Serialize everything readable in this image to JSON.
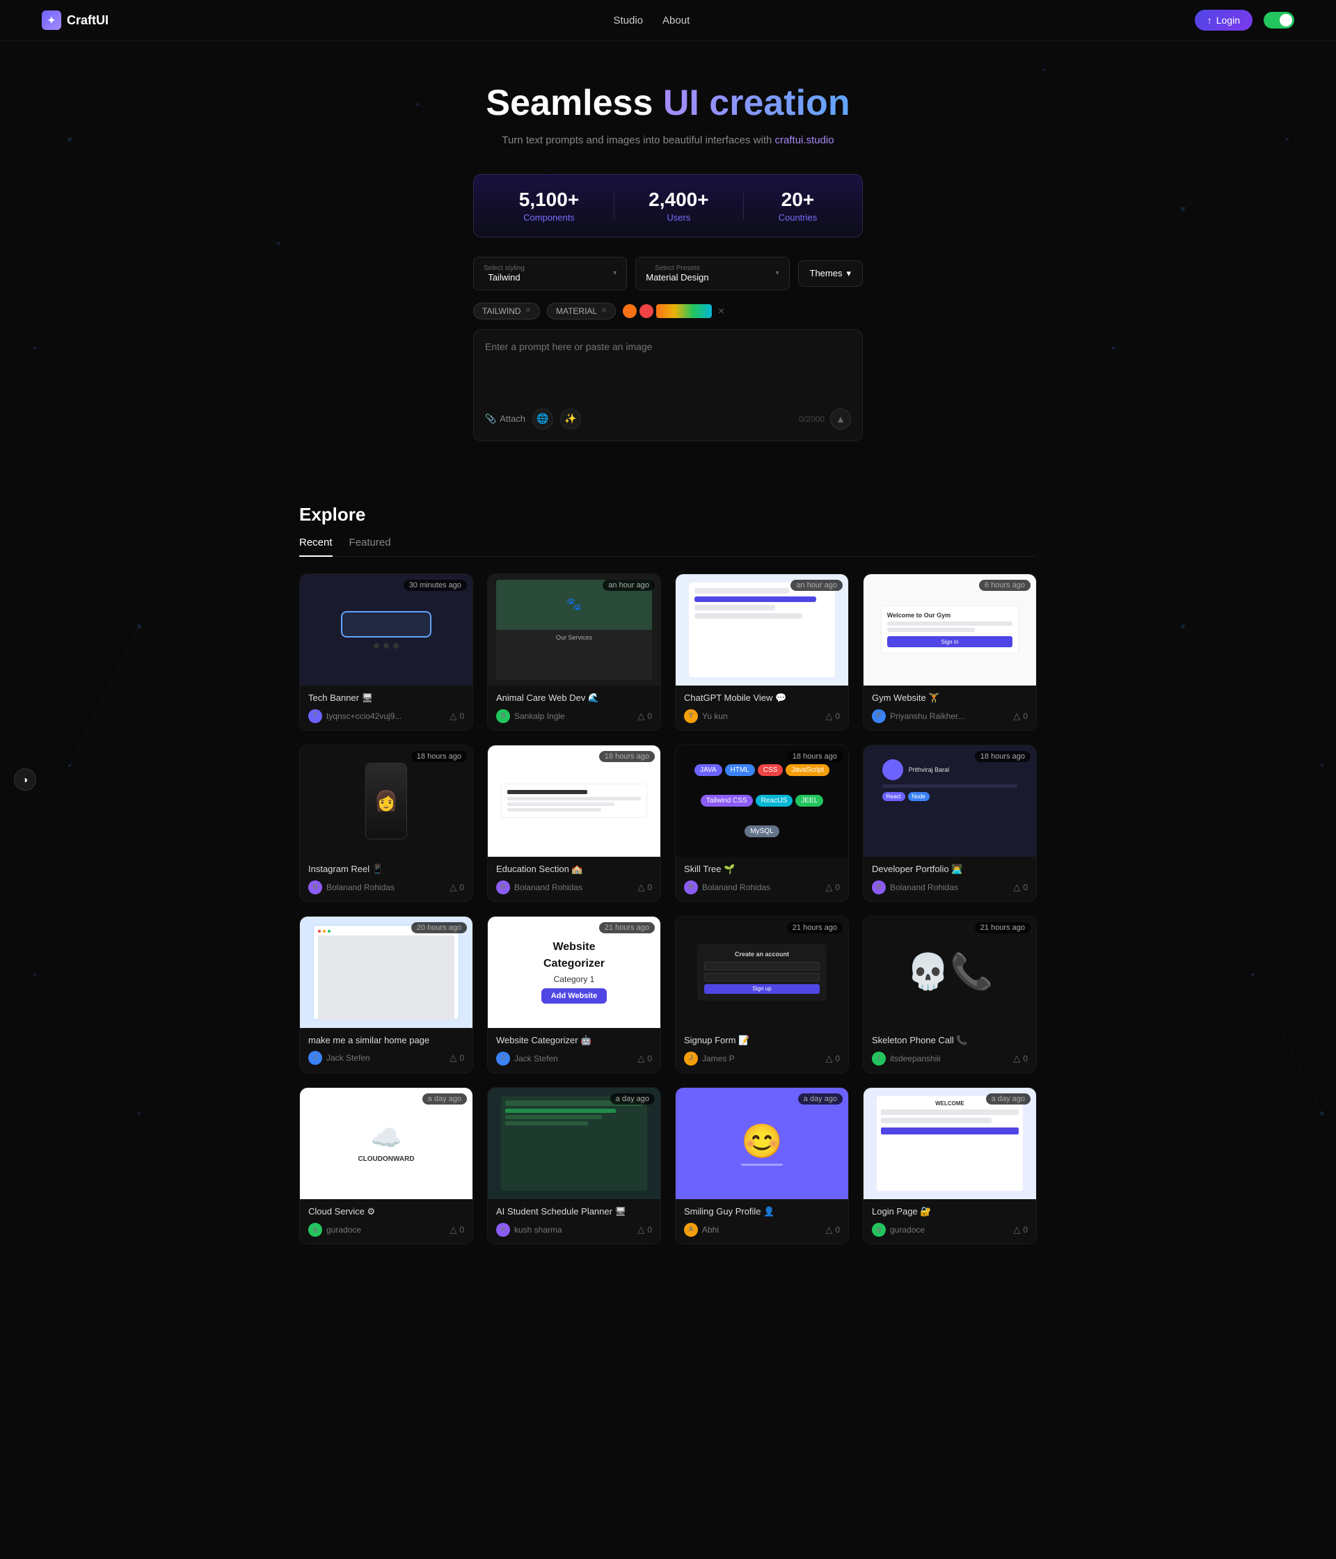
{
  "brand": {
    "name": "CraftUI",
    "logo_emoji": "✦"
  },
  "nav": {
    "login_label": "↑ Login",
    "studio_label": "Studio",
    "about_label": "About"
  },
  "hero": {
    "title_plain": "Seamless",
    "title_highlight": "UI creation",
    "subtitle": "Turn text prompts and images into beautiful interfaces with",
    "subtitle_link": "craftui.studio"
  },
  "stats": [
    {
      "value": "5,100+",
      "label": "Components"
    },
    {
      "value": "2,400+",
      "label": "Users"
    },
    {
      "value": "20+",
      "label": "Countries"
    }
  ],
  "controls": {
    "styling_label": "Select styling",
    "styling_value": "Tailwind",
    "presets_label": "Select Presets",
    "presets_value": "Material Design",
    "themes_label": "Themes"
  },
  "tags": [
    {
      "label": "TAILWIND",
      "id": "tailwind"
    },
    {
      "label": "MATERIAL",
      "id": "material"
    }
  ],
  "prompt": {
    "placeholder": "Enter a prompt here or paste an image",
    "attach_label": "Attach",
    "char_count": "0/2000"
  },
  "explore": {
    "title": "Explore",
    "tabs": [
      {
        "label": "Recent",
        "active": true
      },
      {
        "label": "Featured",
        "active": false
      }
    ]
  },
  "cards": [
    {
      "id": 1,
      "title": "Tech Banner 🖥",
      "author": "tyqnsc+ccio42vuj9...",
      "author_color": "#6c63ff",
      "author_initial": "T",
      "badge": "30 minutes ago",
      "likes": "0",
      "thumb_type": "tech-banner"
    },
    {
      "id": 2,
      "title": "Animal Care Web Dev 🌊",
      "author": "Sankalp Ingle",
      "author_color": "#22c55e",
      "author_initial": "S",
      "badge": "an hour ago",
      "likes": "0",
      "thumb_type": "animal"
    },
    {
      "id": 3,
      "title": "ChatGPT Mobile View 💬",
      "author": "Yu kun",
      "author_color": "#f59e0b",
      "author_initial": "Y",
      "badge": "an hour ago",
      "likes": "0",
      "thumb_type": "chatgpt"
    },
    {
      "id": 4,
      "title": "Gym Website 🏋",
      "author": "Priyanshu Raikher...",
      "author_color": "#3b82f6",
      "author_initial": "P",
      "badge": "6 hours ago",
      "likes": "0",
      "thumb_type": "gym"
    },
    {
      "id": 5,
      "title": "Instagram Reel 📱",
      "author": "Bolanand Rohidas",
      "author_color": "#8b5cf6",
      "author_initial": "B",
      "badge": "18 hours ago",
      "likes": "0",
      "thumb_type": "instagram"
    },
    {
      "id": 6,
      "title": "Education Section 🏫",
      "author": "Bolanand Rohidas",
      "author_color": "#8b5cf6",
      "author_initial": "B",
      "badge": "18 hours ago",
      "likes": "0",
      "thumb_type": "education"
    },
    {
      "id": 7,
      "title": "Skill Tree 🌱",
      "author": "Bolanand Rohidas",
      "author_color": "#8b5cf6",
      "author_initial": "B",
      "badge": "18 hours ago",
      "likes": "0",
      "thumb_type": "skill"
    },
    {
      "id": 8,
      "title": "Developer Portfolio 👨‍💻",
      "author": "Bolanand Rohidas",
      "author_color": "#8b5cf6",
      "author_initial": "B",
      "badge": "18 hours ago",
      "likes": "0",
      "thumb_type": "dev"
    },
    {
      "id": 9,
      "title": "make me a similar home page",
      "author": "Jack Stefen",
      "author_color": "#3b82f6",
      "author_initial": "J",
      "badge": "20 hours ago",
      "likes": "0",
      "thumb_type": "make-home"
    },
    {
      "id": 10,
      "title": "Website Categorizer 🤖",
      "author": "Jack Stefen",
      "author_color": "#3b82f6",
      "author_initial": "J",
      "badge": "21 hours ago",
      "likes": "0",
      "thumb_type": "website-cat"
    },
    {
      "id": 11,
      "title": "Signup Form 📝",
      "author": "James P",
      "author_color": "#f59e0b",
      "author_initial": "J",
      "badge": "21 hours ago",
      "likes": "0",
      "thumb_type": "signup"
    },
    {
      "id": 12,
      "title": "Skeleton Phone Call 📞",
      "author": "itsdeepanshiii",
      "author_color": "#22c55e",
      "author_initial": "i",
      "badge": "21 hours ago",
      "likes": "0",
      "thumb_type": "skeleton"
    },
    {
      "id": 13,
      "title": "Cloud Service ⚙",
      "author": "guradoce",
      "author_color": "#22c55e",
      "author_initial": "g",
      "badge": "a day ago",
      "likes": "0",
      "thumb_type": "cloud"
    },
    {
      "id": 14,
      "title": "AI Student Schedule Planner 🖥",
      "author": "kush sharma",
      "author_color": "#8b5cf6",
      "author_initial": "k",
      "badge": "a day ago",
      "likes": "0",
      "thumb_type": "ai-schedule"
    },
    {
      "id": 15,
      "title": "Smiling Guy Profile 👤",
      "author": "Abhi",
      "author_color": "#f59e0b",
      "author_initial": "A",
      "badge": "a day ago",
      "likes": "0",
      "thumb_type": "smiling"
    },
    {
      "id": 16,
      "title": "Login Page 🔐",
      "author": "guradoce",
      "author_color": "#22c55e",
      "author_initial": "g",
      "badge": "a day ago",
      "likes": "0",
      "thumb_type": "login"
    }
  ]
}
